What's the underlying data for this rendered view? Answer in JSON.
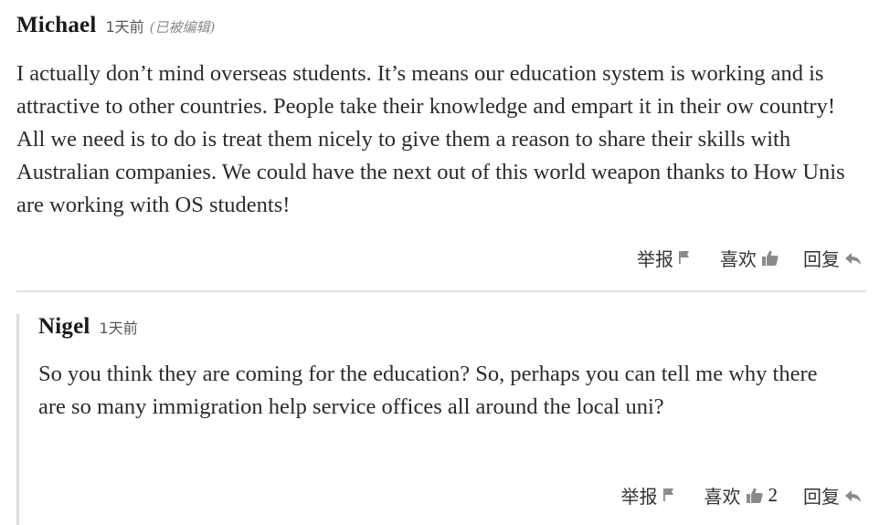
{
  "comments": [
    {
      "author": "Michael",
      "time": "1天前",
      "edited": "(已被编辑)",
      "text": "I actually don’t mind overseas students. It’s means our education system is working and is attractive to other countries. People take their knowledge and empart it in their ow country! All we need is to do is treat them nicely to give them a reason to share their skills with Australian companies. We could have the next out of this world weapon thanks to How Unis are working with OS students!",
      "actions": {
        "report": "举报",
        "like": "喜欢",
        "reply": "回复"
      }
    },
    {
      "author": "Nigel",
      "time": "1天前",
      "text": "So you think they are coming for the education? So, perhaps you can tell me why there are so many immigration help service offices all around the local uni?",
      "actions": {
        "report": "举报",
        "like": "喜欢",
        "like_count": "2",
        "reply": "回复"
      }
    }
  ],
  "icons": {
    "report": "flag-icon",
    "like": "thumbs-up-icon",
    "reply": "reply-arrow-icon"
  },
  "colors": {
    "text": "#2b2b2b",
    "icon": "#8a8a8a",
    "divider": "#e2e2e2",
    "reply_border": "#dcdcdc"
  }
}
